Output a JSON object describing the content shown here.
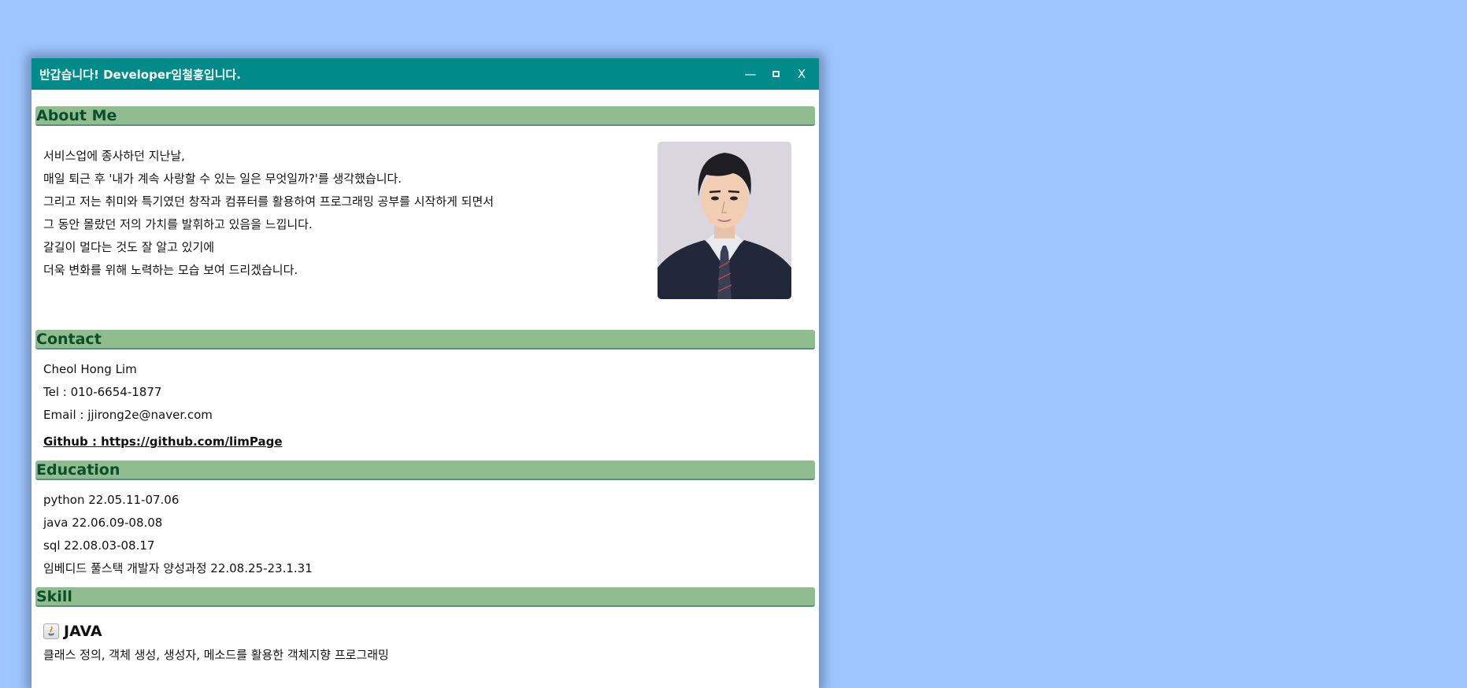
{
  "window": {
    "title": "반갑습니다! Developer임철홍입니다.",
    "minimize_label": "—",
    "close_label": "X"
  },
  "about": {
    "heading": "About Me",
    "lines": [
      "서비스업에 종사하던 지난날,",
      "매일 퇴근 후 '내가 계속 사랑할 수 있는 일은 무엇일까?'를 생각했습니다.",
      "그리고 저는 취미와 특기였던 창작과 컴퓨터를 활용하여 프로그래밍 공부를 시작하게 되면서",
      "그 동안 몰랐던 저의 가치를 발휘하고 있음을 느낍니다.",
      "갈길이 멀다는 것도 잘 알고 있기에",
      "더욱 변화를 위해 노력하는 모습 보여 드리겠습니다."
    ]
  },
  "contact": {
    "heading": "Contact",
    "name": "Cheol Hong Lim",
    "tel": "Tel : 010-6654-1877",
    "email": "Email : jjirong2e@naver.com",
    "github": "Github : https://github.com/limPage"
  },
  "education": {
    "heading": "Education",
    "items": [
      "python 22.05.11-07.06",
      "java 22.06.09-08.08",
      "sql 22.08.03-08.17",
      "임베디드 풀스택 개발자 양성과정 22.08.25-23.1.31"
    ]
  },
  "skill": {
    "heading": "Skill",
    "java_title": "JAVA",
    "java_lines": [
      "클래스 정의, 객체 생성, 생성자, 메소드를 활용한 객체지향 프로그래밍"
    ]
  },
  "colors": {
    "desktop": "#9fc7fe",
    "titlebar": "#008b8a",
    "section_bar": "#8fbd8f",
    "section_text": "#0b4e2a"
  }
}
